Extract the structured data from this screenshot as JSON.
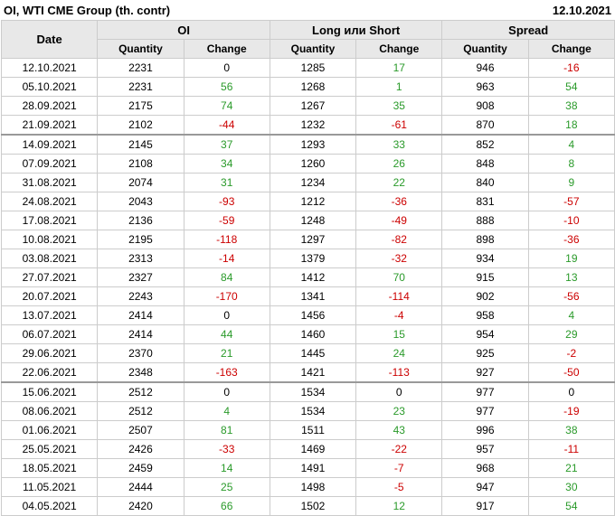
{
  "header": {
    "title": "OI, WTI CME Group (th. contr)",
    "date": "12.10.2021"
  },
  "columns": {
    "date": "Date",
    "groups": [
      "OI",
      "Long или Short",
      "Spread"
    ],
    "sub": [
      "Quantity",
      "Change",
      "Quantity",
      "Change",
      "Quantity",
      "Change"
    ]
  },
  "rows": [
    [
      "12.10.2021",
      "2231",
      "0",
      "1285",
      "17",
      "946",
      "-16"
    ],
    [
      "05.10.2021",
      "2231",
      "56",
      "1268",
      "1",
      "963",
      "54"
    ],
    [
      "28.09.2021",
      "2175",
      "74",
      "1267",
      "35",
      "908",
      "38"
    ],
    [
      "21.09.2021",
      "2102",
      "-44",
      "1232",
      "-61",
      "870",
      "18"
    ],
    [
      "14.09.2021",
      "2145",
      "37",
      "1293",
      "33",
      "852",
      "4"
    ],
    [
      "07.09.2021",
      "2108",
      "34",
      "1260",
      "26",
      "848",
      "8"
    ],
    [
      "31.08.2021",
      "2074",
      "31",
      "1234",
      "22",
      "840",
      "9"
    ],
    [
      "24.08.2021",
      "2043",
      "-93",
      "1212",
      "-36",
      "831",
      "-57"
    ],
    [
      "17.08.2021",
      "2136",
      "-59",
      "1248",
      "-49",
      "888",
      "-10"
    ],
    [
      "10.08.2021",
      "2195",
      "-118",
      "1297",
      "-82",
      "898",
      "-36"
    ],
    [
      "03.08.2021",
      "2313",
      "-14",
      "1379",
      "-32",
      "934",
      "19"
    ],
    [
      "27.07.2021",
      "2327",
      "84",
      "1412",
      "70",
      "915",
      "13"
    ],
    [
      "20.07.2021",
      "2243",
      "-170",
      "1341",
      "-114",
      "902",
      "-56"
    ],
    [
      "13.07.2021",
      "2414",
      "0",
      "1456",
      "-4",
      "958",
      "4"
    ],
    [
      "06.07.2021",
      "2414",
      "44",
      "1460",
      "15",
      "954",
      "29"
    ],
    [
      "29.06.2021",
      "2370",
      "21",
      "1445",
      "24",
      "925",
      "-2"
    ],
    [
      "22.06.2021",
      "2348",
      "-163",
      "1421",
      "-113",
      "927",
      "-50"
    ],
    [
      "15.06.2021",
      "2512",
      "0",
      "1534",
      "0",
      "977",
      "0"
    ],
    [
      "08.06.2021",
      "2512",
      "4",
      "1534",
      "23",
      "977",
      "-19"
    ],
    [
      "01.06.2021",
      "2507",
      "81",
      "1511",
      "43",
      "996",
      "38"
    ],
    [
      "25.05.2021",
      "2426",
      "-33",
      "1469",
      "-22",
      "957",
      "-11"
    ],
    [
      "18.05.2021",
      "2459",
      "14",
      "1491",
      "-7",
      "968",
      "21"
    ],
    [
      "11.05.2021",
      "2444",
      "25",
      "1498",
      "-5",
      "947",
      "30"
    ],
    [
      "04.05.2021",
      "2420",
      "66",
      "1502",
      "12",
      "917",
      "54"
    ]
  ],
  "colors": {
    "positive": "#2a9a2a",
    "negative": "#cc0000"
  }
}
